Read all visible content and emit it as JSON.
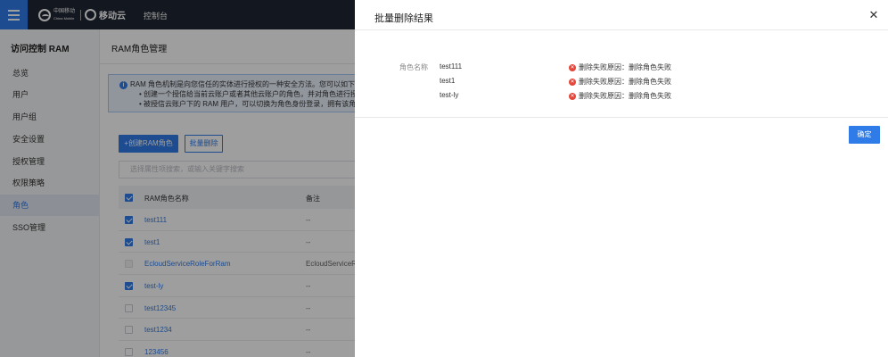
{
  "header": {
    "brand_cn": "中国移动",
    "brand_en": "China Mobile",
    "brand_cloud": "移动云",
    "console_label": "控制台"
  },
  "sidebar": {
    "title": "访问控制 RAM",
    "items": [
      {
        "label": "总览"
      },
      {
        "label": "用户"
      },
      {
        "label": "用户组"
      },
      {
        "label": "安全设置"
      },
      {
        "label": "授权管理"
      },
      {
        "label": "权限策略"
      },
      {
        "label": "角色"
      },
      {
        "label": "SSO管理"
      }
    ]
  },
  "main": {
    "page_title": "RAM角色管理",
    "alert": {
      "line1": "RAM 角色机制是向您信任的实体进行授权的一种安全方法。您可以如下操作",
      "line2": "• 创建一个授信给当前云账户或者其他云账户的角色，并对角色进行授权;",
      "line3": "• 被授信云账户下的 RAM 用户，可以切换为角色身份登录，拥有该角色对应"
    },
    "create_button": "+创建RAM角色",
    "batch_delete_button": "批量删除",
    "filter_placeholder": "选择属性项搜索，或输入关键字搜索",
    "table": {
      "col_name": "RAM角色名称",
      "col_note": "备注",
      "rows": [
        {
          "name": "test111",
          "note": "--"
        },
        {
          "name": "test1",
          "note": "--"
        },
        {
          "name": "EcloudServiceRoleForRam",
          "note": "EcloudServiceRo"
        },
        {
          "name": "test-ly",
          "note": "--"
        },
        {
          "name": "test12345",
          "note": "--"
        },
        {
          "name": "test1234",
          "note": "--"
        },
        {
          "name": "123456",
          "note": "--"
        }
      ]
    }
  },
  "drawer": {
    "title": "批量删除结果",
    "role_label": "角色名称",
    "results": [
      {
        "name": "test111",
        "status": "删除失败原因：删除角色失败"
      },
      {
        "name": "test1",
        "status": "删除失败原因：删除角色失败"
      },
      {
        "name": "test-ly",
        "status": "删除失败原因：删除角色失败"
      }
    ],
    "confirm_button": "确定"
  }
}
